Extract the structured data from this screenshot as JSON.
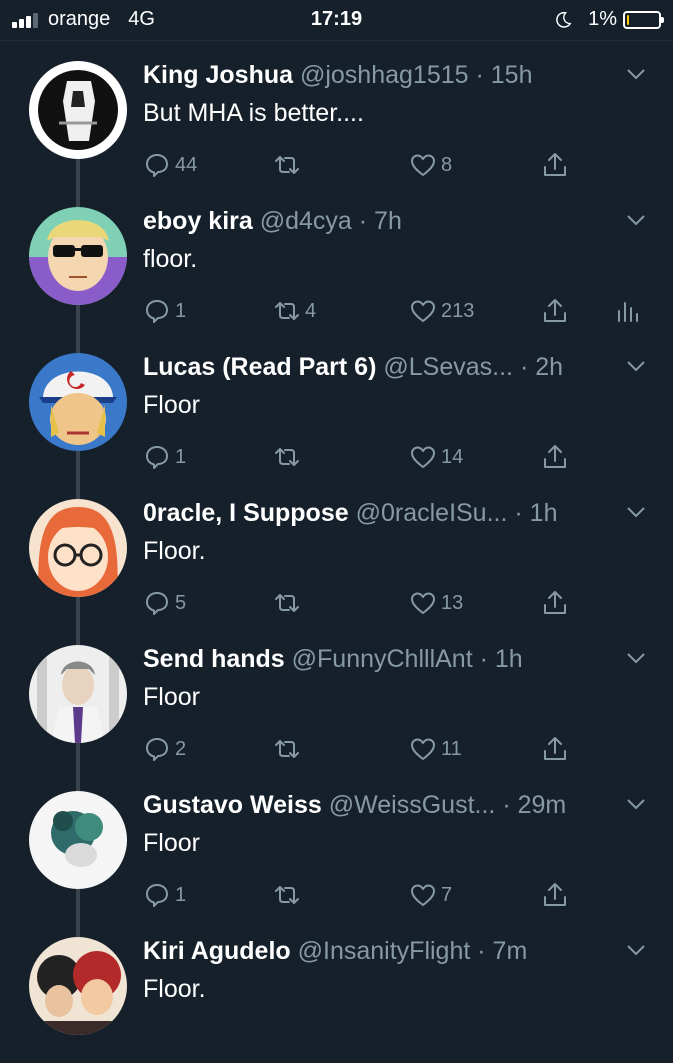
{
  "status_bar": {
    "carrier": "orange",
    "network": "4G",
    "time": "17:19",
    "battery": "1%"
  },
  "colors": {
    "background": "#15202b",
    "secondary_text": "#8899a6",
    "thread_line": "#38444d"
  },
  "icons": {
    "reply": "reply-icon",
    "retweet": "retweet-icon",
    "like": "heart-icon",
    "share": "share-icon",
    "analytics": "analytics-icon",
    "menu": "chevron-down-icon"
  },
  "tweets": [
    {
      "name": "King Joshua",
      "handle": "@joshhag1515",
      "time": "· 15h",
      "text": "But MHA is better....",
      "replies": "44",
      "retweets": "",
      "likes": "8"
    },
    {
      "name": "eboy kira",
      "handle": "@d4cya",
      "time": "· 7h",
      "text": "floor.",
      "replies": "1",
      "retweets": "4",
      "likes": "213"
    },
    {
      "name": "Lucas (Read Part 6)",
      "handle": "@LSevas...",
      "time": "· 2h",
      "text": "Floor",
      "replies": "1",
      "retweets": "",
      "likes": "14"
    },
    {
      "name": "0racle, I Suppose",
      "handle": "@0racleISu...",
      "time": "· 1h",
      "text": "Floor.",
      "replies": "5",
      "retweets": "",
      "likes": "13"
    },
    {
      "name": "Send hands",
      "handle": "@FunnyChlllAnt",
      "time": "· 1h",
      "text": "Floor",
      "replies": "2",
      "retweets": "",
      "likes": "11"
    },
    {
      "name": "Gustavo Weiss",
      "handle": "@WeissGust...",
      "time": "· 29m",
      "text": "Floor",
      "replies": "1",
      "retweets": "",
      "likes": "7"
    },
    {
      "name": "Kiri Agudelo",
      "handle": "@InsanityFlight",
      "time": "· 7m",
      "text": "Floor.",
      "replies": "",
      "retweets": "",
      "likes": ""
    }
  ]
}
